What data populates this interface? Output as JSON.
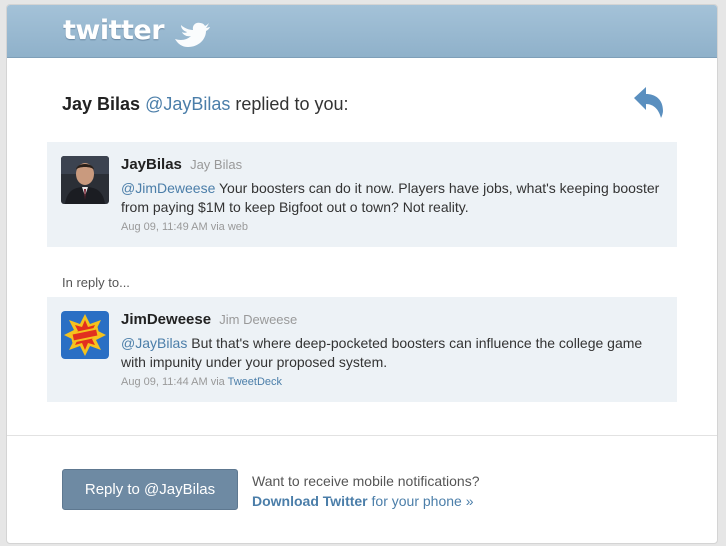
{
  "brand": {
    "logo_text": "twitter",
    "header_color": "#9bbad1",
    "link_color": "#4b7ea9"
  },
  "notification": {
    "sender_name": "Jay Bilas",
    "sender_handle": "@JayBilas",
    "action_text": "replied to you:"
  },
  "tweets": [
    {
      "screen_name": "JayBilas",
      "full_name": "Jay Bilas",
      "mention": "@JimDeweese",
      "text": "Your boosters can do it now. Players have jobs, what's keeping booster from paying $1M to keep Bigfoot out o town? Not reality.",
      "timestamp": "Aug 09, 11:49 AM via",
      "via": "web",
      "avatar": "photo-avatar"
    },
    {
      "screen_name": "JimDeweese",
      "full_name": "Jim Deweese",
      "mention": "@JayBilas",
      "text": "But that's where deep-pocketed boosters can influence the college game with impunity under your proposed system.",
      "timestamp": "Aug 09, 11:44 AM via",
      "via": "TweetDeck",
      "avatar": "comic-avatar"
    }
  ],
  "in_reply_label": "In reply to...",
  "footer": {
    "reply_button_label": "Reply to @JayBilas",
    "promo_line": "Want to receive mobile notifications?",
    "download_link_bold": "Download Twitter",
    "download_link_rest": "for your phone »"
  }
}
